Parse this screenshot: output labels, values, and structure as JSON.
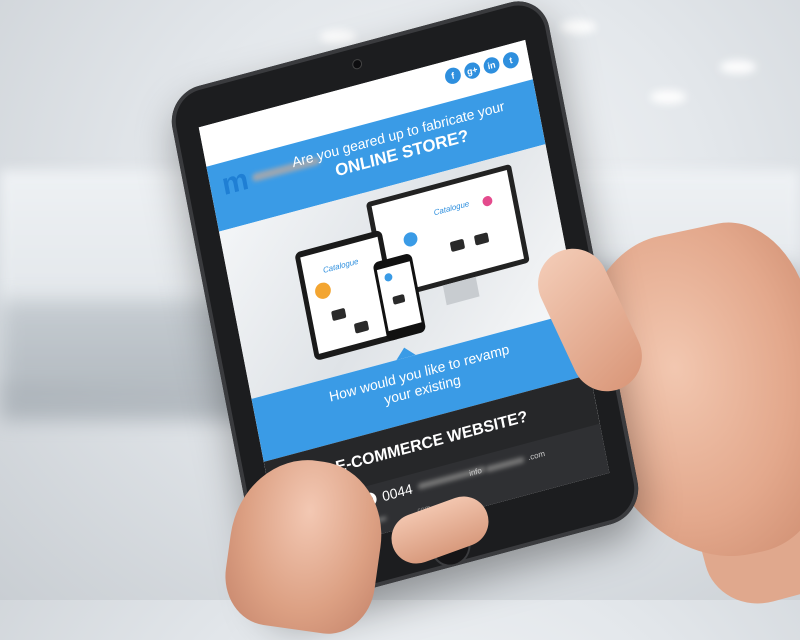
{
  "social_icons": [
    {
      "icon": "facebook-icon",
      "glyph": "f"
    },
    {
      "icon": "google-plus-icon",
      "glyph": "g+"
    },
    {
      "icon": "linkedin-icon",
      "glyph": "in"
    },
    {
      "icon": "twitter-icon",
      "glyph": "t"
    }
  ],
  "logo": {
    "mark": "m"
  },
  "headline_top": {
    "line1": "Are you geared up to fabricate your",
    "line2": "ONLINE STORE?"
  },
  "mockups": {
    "brand_text": "Catalogue",
    "accent_color": "#3a9be6"
  },
  "headline_middle": {
    "line1": "How would you like to revamp",
    "line2": "your existing"
  },
  "headline_bottom": "E-COMMERCE WEBSITE?",
  "contact": {
    "phone_prefix": "0044",
    "email_prefix": "info",
    "domain_suffix": ".com",
    "footer_suffix": ".com"
  },
  "colors": {
    "brand_blue": "#3a9be6",
    "dark_band": "#262729"
  }
}
